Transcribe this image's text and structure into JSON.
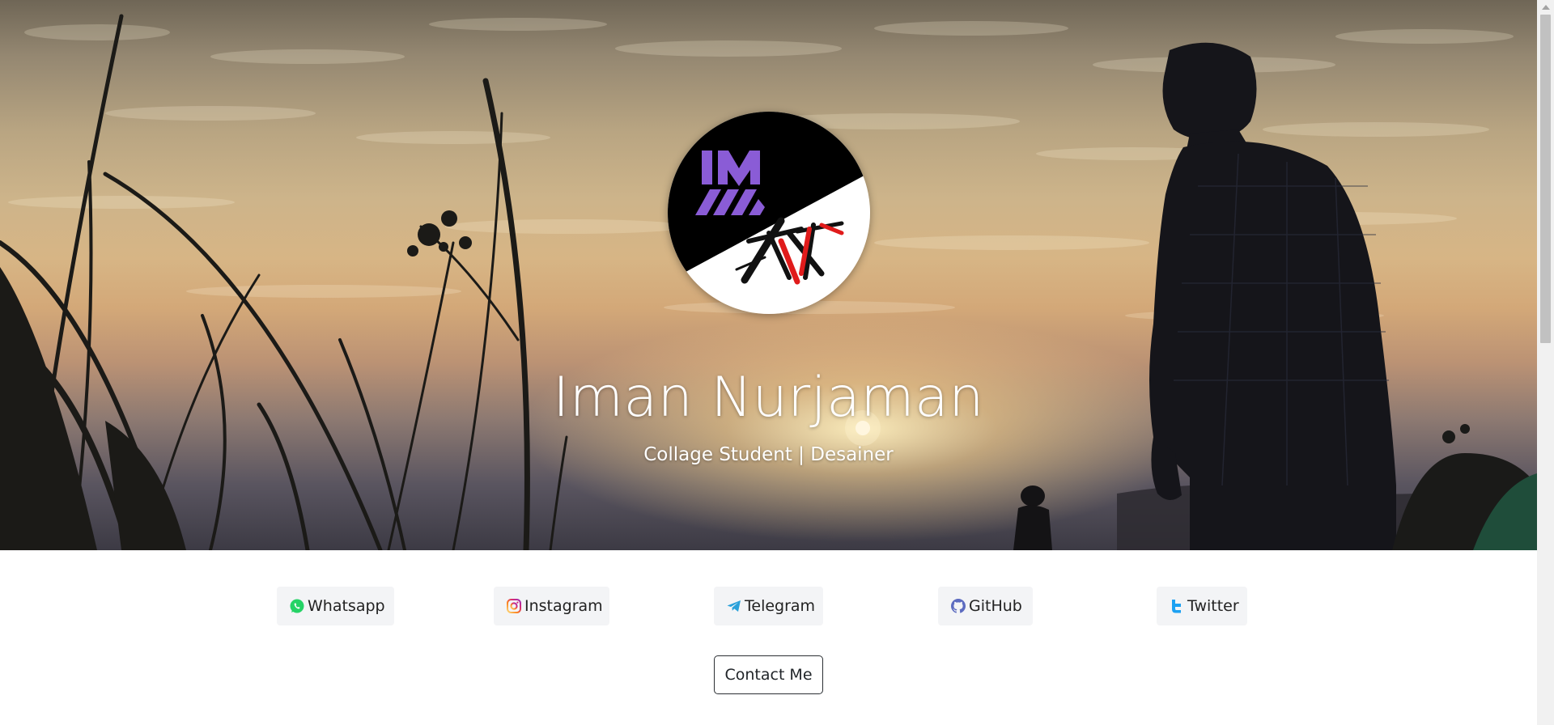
{
  "hero": {
    "title": "Iman Nurjaman",
    "subtitle": "Collage Student | Desainer",
    "avatar_logos": [
      "IMN monogram",
      "KN brush mark"
    ]
  },
  "social_links": [
    {
      "label": "Whatsapp",
      "icon": "whatsapp-icon",
      "color": "#25d366"
    },
    {
      "label": "Instagram",
      "icon": "instagram-icon",
      "color": "#d62976"
    },
    {
      "label": "Telegram",
      "icon": "telegram-icon",
      "color": "#2aa1da"
    },
    {
      "label": "GitHub",
      "icon": "github-icon",
      "color": "#5c6bc0"
    },
    {
      "label": "Twitter",
      "icon": "twitter-icon",
      "color": "#1da1f2"
    }
  ],
  "contact": {
    "label": "Contact Me"
  },
  "colors": {
    "avatar_purple": "#8a5cd6",
    "avatar_red": "#e01b1b",
    "button_background": "#f3f4f6",
    "button_border": "#2b2f33"
  }
}
